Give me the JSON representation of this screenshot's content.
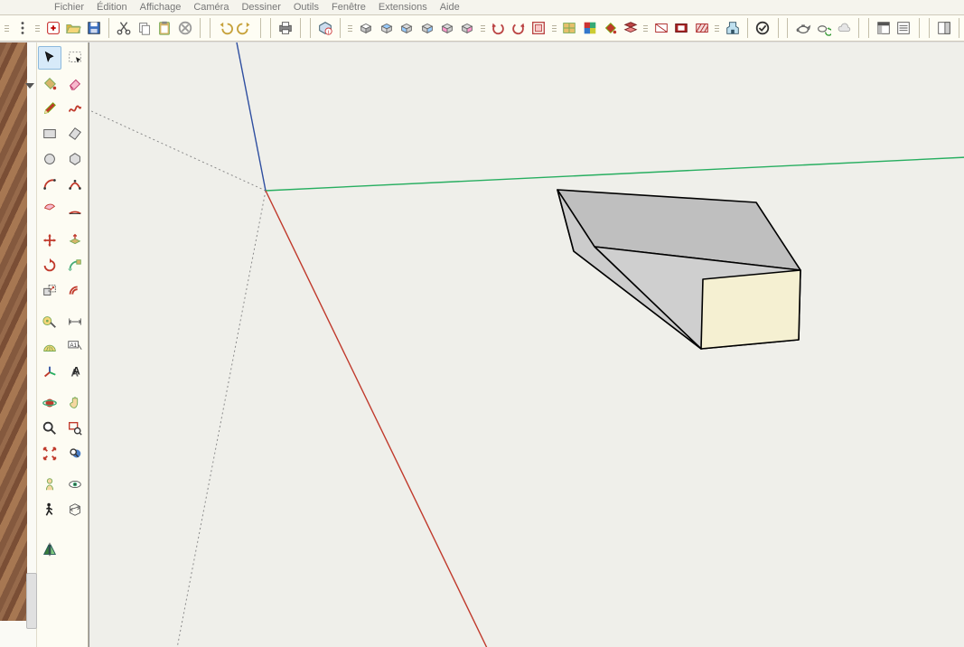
{
  "menu": {
    "items": [
      "Fichier",
      "Édition",
      "Affichage",
      "Caméra",
      "Dessiner",
      "Outils",
      "Fenêtre",
      "Extensions",
      "Aide"
    ]
  },
  "toolbar": {
    "groups": [
      {
        "_grip": true,
        "_icons": [
          "kebab-icon"
        ]
      },
      {
        "_grip": true,
        "_icons": [
          "new-model-icon",
          "open-file-icon",
          "save-icon"
        ]
      },
      {
        "_icons": [
          "cut-icon",
          "copy-icon",
          "paste-icon",
          "delete-icon"
        ]
      },
      {
        "_icons": [
          "undo-icon",
          "redo-icon"
        ]
      },
      {
        "_icons": [
          "print-icon"
        ]
      },
      {
        "_icons": [
          "model-info-icon"
        ]
      },
      {
        "_grip": true,
        "_icons": [
          "iso-view-icon",
          "top-view-icon",
          "front-view-icon",
          "back-view-icon",
          "left-view-icon",
          "right-view-icon"
        ]
      },
      {
        "_grip": true,
        "_icons": [
          "undo-view-icon",
          "redo-view-icon",
          "view-extents-icon"
        ]
      },
      {
        "_grip": true,
        "_icons": [
          "component-library-icon",
          "materials-icon",
          "paint-bucket-red-icon",
          "layers-icon"
        ]
      },
      {
        "_grip": true,
        "_icons": [
          "section-plane-icon",
          "section-display-icon",
          "section-fill-icon"
        ]
      },
      {
        "_grip": true,
        "_icons": [
          "extension-warehouse-icon"
        ]
      },
      {
        "_icons": [
          "validate-icon"
        ]
      },
      {
        "_icons": [
          "teapot-icon",
          "teapot-sync-icon",
          "cloud-icon"
        ]
      },
      {
        "_icons": [
          "layout-icon",
          "outliner-icon"
        ]
      },
      {
        "_icons": [
          "panel-icon"
        ]
      }
    ]
  },
  "tools": {
    "rows": [
      [
        "select",
        "rect-select"
      ],
      [
        "paint-bucket",
        "eraser"
      ],
      [
        "pencil",
        "freehand"
      ],
      [
        "rectangle",
        "rectangle-rot"
      ],
      [
        "circle",
        "polygon"
      ],
      [
        "arc-2pt",
        "arc-3pt"
      ],
      [
        "arc-pie",
        "arc-tangent"
      ],
      [
        "_spacer"
      ],
      [
        "move",
        "push-pull"
      ],
      [
        "rotate",
        "follow-me"
      ],
      [
        "scale",
        "offset"
      ],
      [
        "_spacer"
      ],
      [
        "tape-measure",
        "dimension"
      ],
      [
        "protractor",
        "text-label"
      ],
      [
        "axes",
        "3d-text"
      ],
      [
        "_spacer"
      ],
      [
        "orbit",
        "pan"
      ],
      [
        "zoom",
        "zoom-window"
      ],
      [
        "zoom-extents",
        "prev-view"
      ],
      [
        "_spacer"
      ],
      [
        "position-camera",
        "look-around"
      ],
      [
        "walk",
        "section-plane"
      ],
      [
        "_spacer-lg"
      ],
      [
        "mirror",
        ""
      ]
    ],
    "selected": "select"
  },
  "axes": {
    "red": "#c0392b",
    "green": "#27ae60",
    "blue": "#2e4ea0",
    "dotted": "#8a8a8a"
  },
  "solid": {
    "face_front": "#f5f0d2",
    "face_top": "#bfbfbf",
    "face_side": "#cccccc",
    "edge": "#000"
  }
}
